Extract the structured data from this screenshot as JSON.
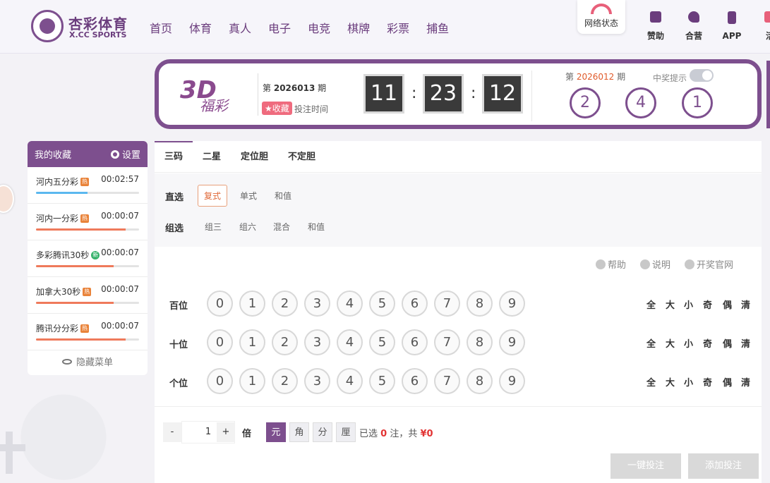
{
  "header": {
    "brand_cn": "杏彩体育",
    "brand_en": "X.CC SPORTS",
    "nav": [
      "首页",
      "体育",
      "真人",
      "电子",
      "电竞",
      "棋牌",
      "彩票",
      "捕鱼"
    ],
    "network_status": "网络状态",
    "icons": [
      {
        "label": "赞助",
        "icon": "bookmark-icon"
      },
      {
        "label": "合营",
        "icon": "handshake-icon"
      },
      {
        "label": "APP",
        "icon": "phone-icon"
      },
      {
        "label": "活",
        "icon": "gift-icon"
      }
    ]
  },
  "banner": {
    "logo_main": "3D",
    "logo_sub": "福彩",
    "current_issue_prefix": "第",
    "current_issue": "2026013",
    "current_issue_suffix": "期",
    "fav_label": "收藏",
    "deadline_label": "投注时间",
    "clock": {
      "h": "11",
      "m": "23",
      "s": "12"
    },
    "prev_issue_prefix": "第",
    "prev_issue": "2026012",
    "prev_issue_suffix": "期",
    "hint_label": "中奖提示",
    "result_balls": [
      "2",
      "4",
      "1"
    ]
  },
  "favorites": {
    "title": "我的收藏",
    "settings": "设置",
    "items": [
      {
        "name": "河内五分彩",
        "tag": "热",
        "time": "00:02:57",
        "progress": 0.5,
        "color": "#5bb8ef"
      },
      {
        "name": "河内一分彩",
        "tag": "热",
        "time": "00:00:07",
        "progress": 0.87,
        "color": "#ef7a5b"
      },
      {
        "name": "多彩腾讯30秒",
        "tag": "新",
        "time": "00:00:07",
        "progress": 0.75,
        "color": "#ef7a5b"
      },
      {
        "name": "加拿大30秒",
        "tag": "热",
        "time": "00:00:07",
        "progress": 0.75,
        "color": "#ef7a5b"
      },
      {
        "name": "腾讯分分彩",
        "tag": "热",
        "time": "00:00:07",
        "progress": 0.87,
        "color": "#ef7a5b"
      }
    ],
    "hide_menu": "隐藏菜单"
  },
  "main": {
    "tabs": [
      "三码",
      "二星",
      "定位胆",
      "不定胆"
    ],
    "direct_label": "直选",
    "direct_options": [
      "复式",
      "单式",
      "和值"
    ],
    "group_label": "组选",
    "group_options": [
      "组三",
      "组六",
      "混合",
      "和值"
    ],
    "help_links": [
      "帮助",
      "说明",
      "开奖官网"
    ],
    "rows": [
      "百位",
      "十位",
      "个位"
    ],
    "digits": [
      "0",
      "1",
      "2",
      "3",
      "4",
      "5",
      "6",
      "7",
      "8",
      "9"
    ],
    "quick": [
      "全",
      "大",
      "小",
      "奇",
      "偶",
      "清"
    ],
    "minus": "-",
    "multiplier": "1",
    "plus": "+",
    "times_label": "倍",
    "units": [
      "元",
      "角",
      "分",
      "厘"
    ],
    "summary_prefix": "已选",
    "selected_count": "0",
    "summary_mid": "注，共",
    "amount": "¥0",
    "quick_bet": "一键投注",
    "add_bet": "添加投注"
  }
}
